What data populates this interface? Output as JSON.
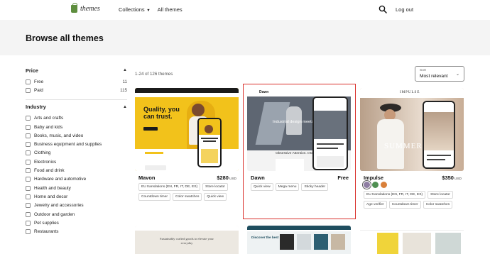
{
  "header": {
    "logo_text": "themes",
    "nav": [
      {
        "label": "Collections",
        "has_dropdown": true
      },
      {
        "label": "All themes",
        "has_dropdown": false
      }
    ],
    "logout_label": "Log out",
    "brand_color": "#5e8e3e"
  },
  "page": {
    "title": "Browse all themes"
  },
  "filters": {
    "price": {
      "heading": "Price",
      "options": [
        {
          "label": "Free",
          "count": "11"
        },
        {
          "label": "Paid",
          "count": "115"
        }
      ]
    },
    "industry": {
      "heading": "Industry",
      "options": [
        {
          "label": "Arts and crafts"
        },
        {
          "label": "Baby and kids"
        },
        {
          "label": "Books, music, and video"
        },
        {
          "label": "Business equipment and supplies"
        },
        {
          "label": "Clothing"
        },
        {
          "label": "Electronics"
        },
        {
          "label": "Food and drink"
        },
        {
          "label": "Hardware and automotive"
        },
        {
          "label": "Health and beauty"
        },
        {
          "label": "Home and decor"
        },
        {
          "label": "Jewelry and accessories"
        },
        {
          "label": "Outdoor and garden"
        },
        {
          "label": "Pet supplies"
        },
        {
          "label": "Restaurants"
        }
      ]
    }
  },
  "results": {
    "count_text": "1-24 of 126 themes",
    "sort_label": "Sort",
    "sort_value": "Most relevant"
  },
  "themes": [
    {
      "name": "Mavon",
      "price": "$280",
      "currency": "USD",
      "tags": [
        "EU translations (EN, FR, IT, DE, ES)",
        "Store locator",
        "Countdown timer",
        "Color swatches",
        "Quick view"
      ],
      "preview_headline": "Quality, you can trust.",
      "accent": "#f2c21b"
    },
    {
      "name": "Dawn",
      "price": "Free",
      "currency": "",
      "tags": [
        "Quick view",
        "Mega menu",
        "Sticky header"
      ],
      "preview_brand": "Dawn",
      "preview_headline": "Industrial design meets fashion.",
      "preview_sub": "Obsessive Attention. Intelligent Effort.",
      "highlighted": true,
      "highlight_color": "#d9302b"
    },
    {
      "name": "Impulse",
      "price": "$350",
      "currency": "USD",
      "tags": [
        "EU translations (EN, FR, IT, DE, ES)",
        "Store locator",
        "Age verifier",
        "Countdown timer",
        "Color swatches"
      ],
      "preview_brand": "IMPULSE",
      "preview_headline": "SUMMER",
      "swatches": [
        "#8f7ea3",
        "#4f8f52",
        "#d9803a"
      ]
    }
  ],
  "second_row_previews": [
    {
      "caption": "Sustainably crafted goods to elevate your everyday"
    },
    {
      "caption": "Discover the best"
    },
    {
      "caption": ""
    }
  ]
}
